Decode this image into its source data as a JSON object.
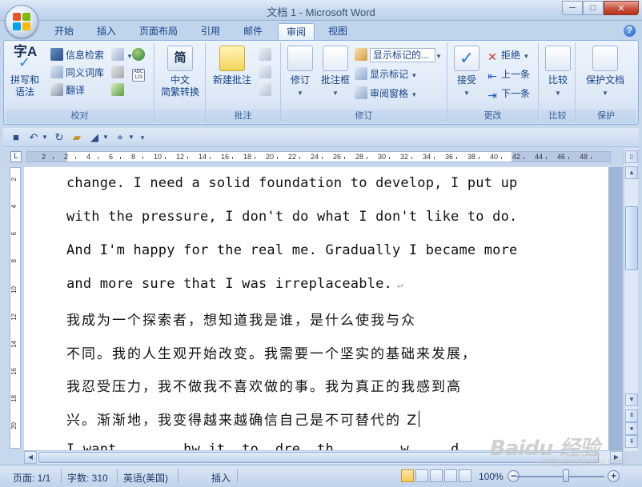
{
  "window": {
    "title": "文档 1 - Microsoft Word",
    "minimize": "─",
    "maximize": "□",
    "close": "✕"
  },
  "tabs": [
    {
      "label": "开始"
    },
    {
      "label": "插入"
    },
    {
      "label": "页面布局"
    },
    {
      "label": "引用"
    },
    {
      "label": "邮件"
    },
    {
      "label": "审阅"
    },
    {
      "label": "视图"
    }
  ],
  "help": "?",
  "ribbon": {
    "proofing": {
      "label": "校对",
      "spelling": "拼写和\n语法",
      "research": "信息检索",
      "thesaurus": "同义词库",
      "translate": "翻译"
    },
    "chinese": {
      "label": "中文\n简繁转换",
      "icon_text": "简"
    },
    "comments": {
      "label": "批注",
      "new_comment": "新建批注"
    },
    "tracking": {
      "label": "修订",
      "track_changes": "修订",
      "balloons": "批注框",
      "display_mode": "显示标记的...",
      "show_markup": "显示标记",
      "review_pane": "审阅窗格"
    },
    "changes": {
      "label": "更改",
      "accept": "接受",
      "reject": "拒绝",
      "previous": "上一条",
      "next": "下一条"
    },
    "compare": {
      "label": "比较",
      "compare": "比较"
    },
    "protect": {
      "label": "保护",
      "protect_doc": "保护文档"
    }
  },
  "ruler": {
    "corner": "L",
    "numbers": [
      "2",
      "2",
      "4",
      "6",
      "8",
      "10",
      "12",
      "14",
      "16",
      "18",
      "20",
      "22",
      "24",
      "26",
      "28",
      "30",
      "32",
      "34",
      "36",
      "38",
      "40",
      "42",
      "44",
      "46",
      "48"
    ],
    "vertical_numbers": [
      "2",
      "4",
      "6",
      "8",
      "10",
      "12",
      "14",
      "16",
      "18",
      "20"
    ]
  },
  "document": {
    "lines": [
      {
        "text": "change. I need a solid foundation to develop, I put up",
        "type": "en"
      },
      {
        "text": "with the pressure, I don't do what I don't like to do.",
        "type": "en"
      },
      {
        "text": "And I'm happy for the real me. Gradually I became more",
        "type": "en"
      },
      {
        "text": "and more sure that I was irreplaceable.",
        "type": "en",
        "mark": "↵"
      },
      {
        "text": "    我成为一个探索者，想知道我是谁，是什么使我与众",
        "type": "cn"
      },
      {
        "text": "不同。我的人生观开始改变。我需要一个坚实的基础来发展，",
        "type": "cn"
      },
      {
        "text": "我忍受压力，我不做我不喜欢做的事。我为真正的我感到高",
        "type": "cn"
      },
      {
        "text": "兴。渐渐地，我变得越来越确信自己是不可替代的 Z",
        "type": "cn"
      },
      {
        "text": "    I want........hw.it..to..dre..th........w.....d",
        "type": "en"
      }
    ]
  },
  "statusbar": {
    "page": "页面: 1/1",
    "words": "字数: 310",
    "language": "英语(美国)",
    "mode": "插入",
    "zoom": "100%",
    "zoom_out": "−",
    "zoom_in": "+"
  },
  "watermark": {
    "main": "Baidu 经验",
    "sub": "jingyan.baidu.com"
  },
  "colors": {
    "ribbon_text": "#15428b",
    "accent": "#8db2e3"
  }
}
